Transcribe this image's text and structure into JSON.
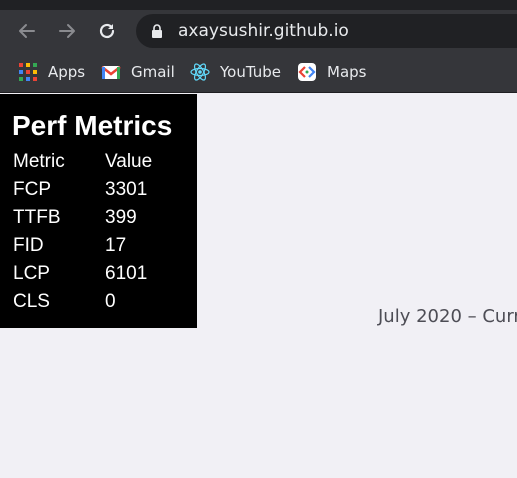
{
  "browser": {
    "url": "axaysushir.github.io",
    "bookmarks": [
      {
        "label": "Apps",
        "icon": "apps-grid-icon"
      },
      {
        "label": "Gmail",
        "icon": "gmail-icon"
      },
      {
        "label": "YouTube",
        "icon": "react-icon"
      },
      {
        "label": "Maps",
        "icon": "maps-icon"
      }
    ]
  },
  "perf_metrics": {
    "title": "Perf Metrics",
    "headers": [
      "Metric",
      "Value"
    ],
    "rows": [
      {
        "metric": "FCP",
        "value": "3301"
      },
      {
        "metric": "TTFB",
        "value": "399"
      },
      {
        "metric": "FID",
        "value": "17"
      },
      {
        "metric": "LCP",
        "value": "6101"
      },
      {
        "metric": "CLS",
        "value": "0"
      }
    ]
  },
  "page": {
    "date_text": "July 2020 – Curr"
  },
  "colors": {
    "toolbar": "#35363a",
    "omnibox": "#202124",
    "page_background": "#f1f0f5",
    "panel": "#000000"
  }
}
